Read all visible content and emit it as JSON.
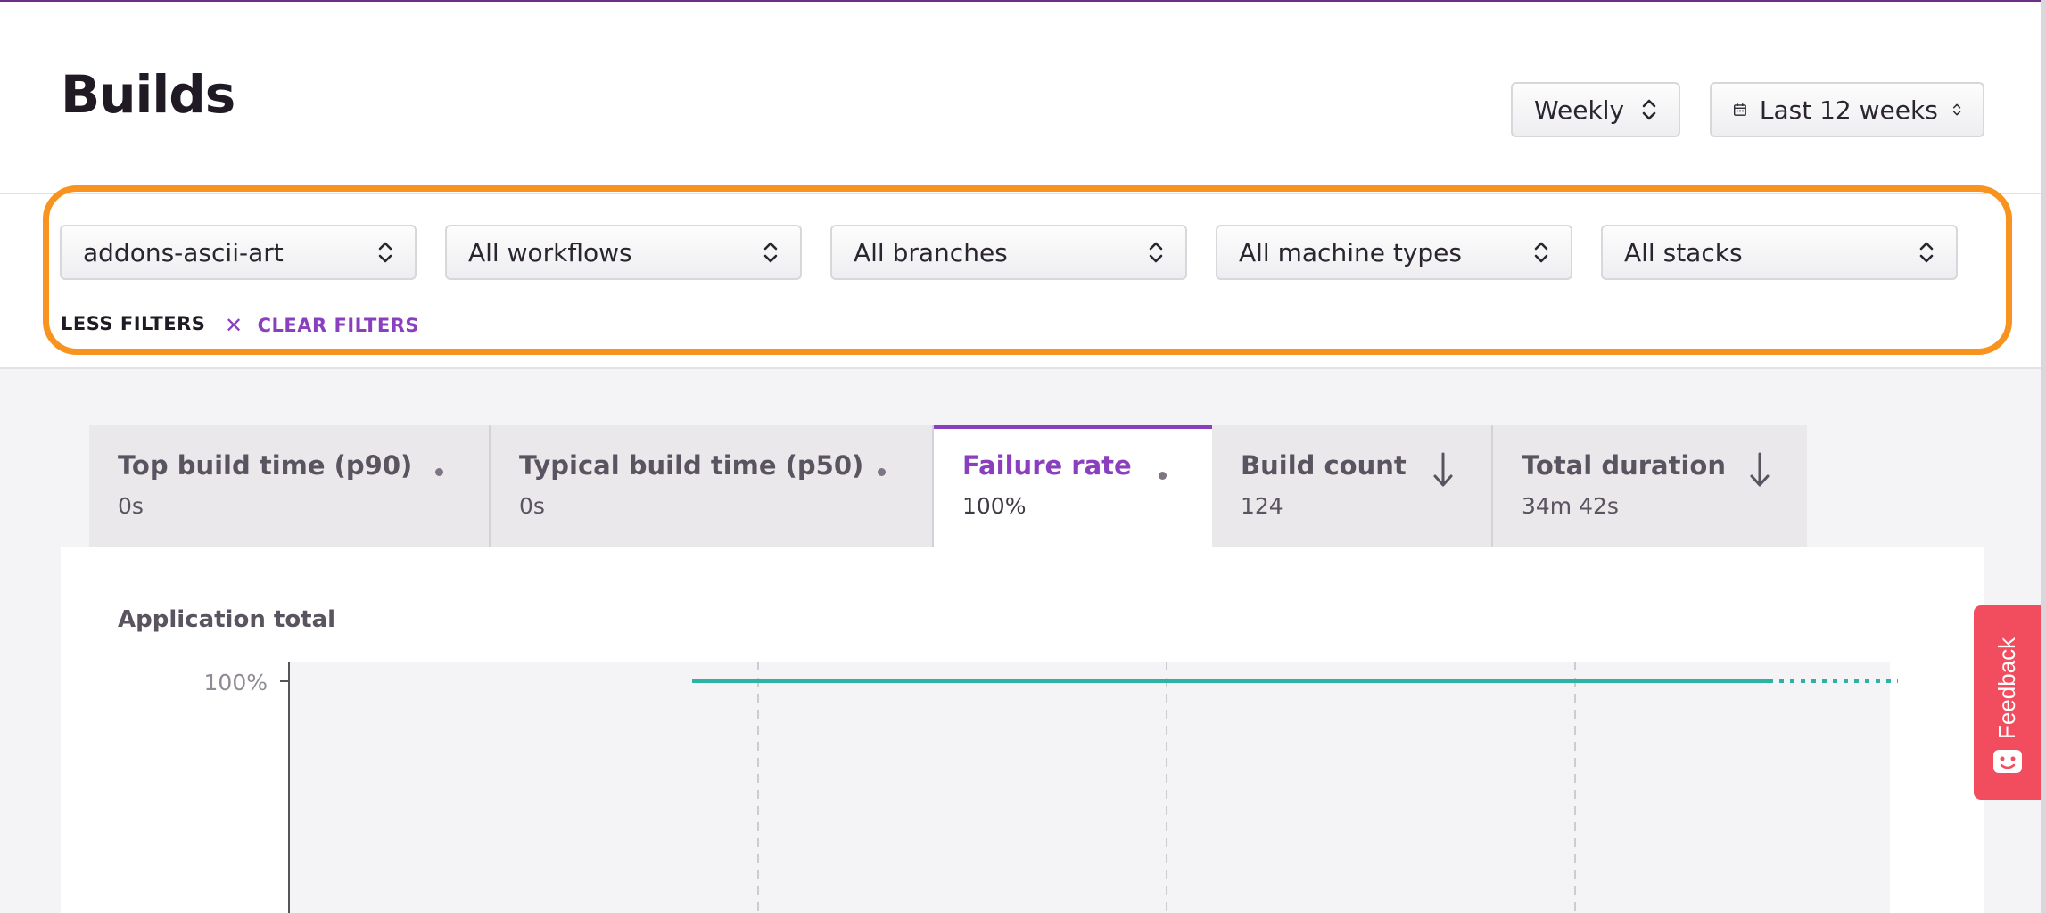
{
  "header": {
    "title": "Builds",
    "interval_label": "Weekly",
    "date_range_label": "Last 12 weeks"
  },
  "filters": {
    "app": "addons-ascii-art",
    "workflow": "All workflows",
    "branch": "All branches",
    "machine_type": "All machine types",
    "stack": "All stacks",
    "less_filters": "LESS FILTERS",
    "clear_filters": "CLEAR FILTERS"
  },
  "tabs": [
    {
      "title": "Top build time (p90)",
      "value": "0s",
      "indicator": "dot"
    },
    {
      "title": "Typical build time (p50)",
      "value": "0s",
      "indicator": "dot"
    },
    {
      "title": "Failure rate",
      "value": "100%",
      "indicator": "dot",
      "active": true
    },
    {
      "title": "Build count",
      "value": "124",
      "indicator": "arrow-down"
    },
    {
      "title": "Total duration",
      "value": "34m 42s",
      "indicator": "arrow-down"
    }
  ],
  "panel": {
    "title": "Application total"
  },
  "feedback": {
    "label": "Feedback"
  },
  "colors": {
    "accent": "#8a3fbf",
    "highlight": "#f7931e",
    "line": "#2db3a3",
    "feedback": "#f24c5f"
  },
  "chart_data": {
    "type": "line",
    "series": [
      {
        "values": [
          100,
          100,
          100,
          100
        ],
        "segment": "solid"
      },
      {
        "values": [
          100,
          100
        ],
        "segment": "dotted"
      }
    ],
    "yticks": [
      "100%"
    ],
    "ylim_top": 100
  }
}
